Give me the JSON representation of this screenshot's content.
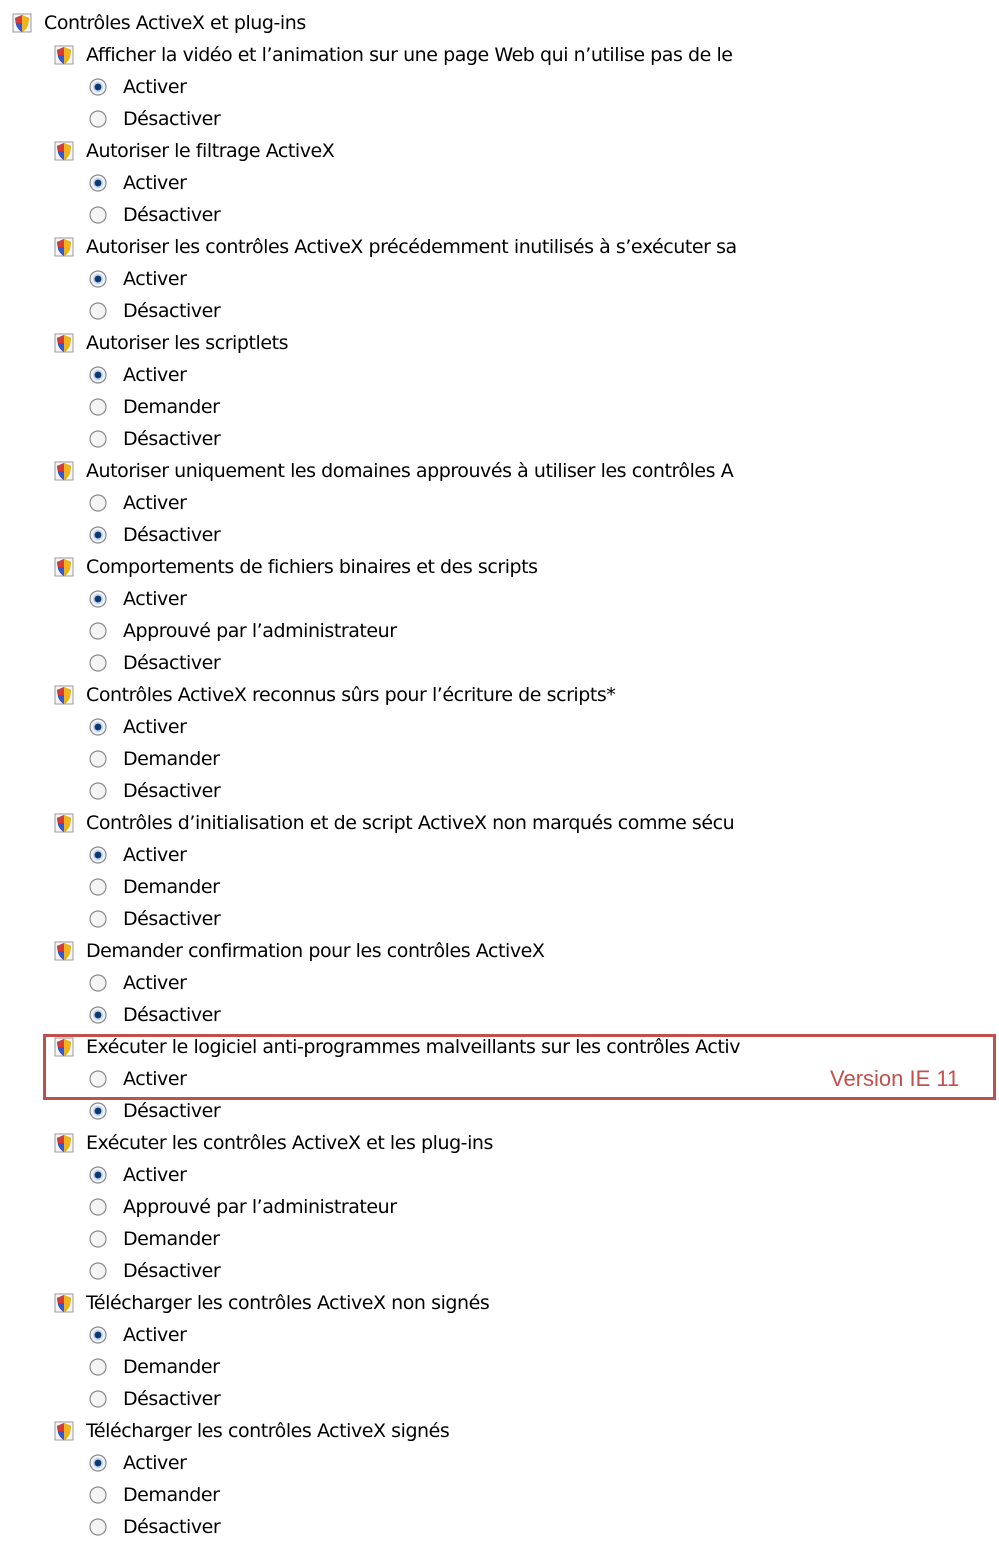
{
  "root": {
    "label": "Contrôles ActiveX et plug-ins",
    "icon": "security-settings-icon"
  },
  "settings": [
    {
      "label": "Afficher la vidéo et l’animation sur une page Web qui n’utilise pas de le",
      "icon": "security-settings-icon",
      "options": [
        {
          "label": "Activer",
          "selected": true
        },
        {
          "label": "Désactiver",
          "selected": false
        }
      ]
    },
    {
      "label": "Autoriser le filtrage ActiveX",
      "icon": "security-settings-icon",
      "options": [
        {
          "label": "Activer",
          "selected": true
        },
        {
          "label": "Désactiver",
          "selected": false
        }
      ]
    },
    {
      "label": "Autoriser les contrôles ActiveX précédemment inutilisés à s’exécuter sa",
      "icon": "security-settings-icon",
      "options": [
        {
          "label": "Activer",
          "selected": true
        },
        {
          "label": "Désactiver",
          "selected": false
        }
      ]
    },
    {
      "label": "Autoriser les scriptlets",
      "icon": "security-settings-icon",
      "options": [
        {
          "label": "Activer",
          "selected": true
        },
        {
          "label": "Demander",
          "selected": false
        },
        {
          "label": "Désactiver",
          "selected": false
        }
      ]
    },
    {
      "label": "Autoriser uniquement les domaines approuvés à utiliser les contrôles A",
      "icon": "security-settings-icon",
      "options": [
        {
          "label": "Activer",
          "selected": false
        },
        {
          "label": "Désactiver",
          "selected": true
        }
      ]
    },
    {
      "label": "Comportements de fichiers binaires et des scripts",
      "icon": "security-settings-icon",
      "options": [
        {
          "label": "Activer",
          "selected": true
        },
        {
          "label": "Approuvé par l’administrateur",
          "selected": false
        },
        {
          "label": "Désactiver",
          "selected": false
        }
      ]
    },
    {
      "label": "Contrôles ActiveX reconnus sûrs pour l’écriture de scripts*",
      "icon": "security-settings-icon",
      "options": [
        {
          "label": "Activer",
          "selected": true
        },
        {
          "label": "Demander",
          "selected": false
        },
        {
          "label": "Désactiver",
          "selected": false
        }
      ]
    },
    {
      "label": "Contrôles d’initialisation et de script ActiveX non marqués comme sécu",
      "icon": "security-settings-icon",
      "options": [
        {
          "label": "Activer",
          "selected": true
        },
        {
          "label": "Demander",
          "selected": false
        },
        {
          "label": "Désactiver",
          "selected": false
        }
      ]
    },
    {
      "label": "Demander confirmation pour les contrôles ActiveX",
      "icon": "security-settings-icon",
      "options": [
        {
          "label": "Activer",
          "selected": false
        },
        {
          "label": "Désactiver",
          "selected": true
        }
      ]
    },
    {
      "label": "Exécuter le logiciel anti-programmes malveillants sur les contrôles Activ",
      "icon": "security-settings-icon",
      "highlighted": true,
      "options": [
        {
          "label": "Activer",
          "selected": false
        },
        {
          "label": "Désactiver",
          "selected": true
        }
      ]
    },
    {
      "label": "Exécuter les contrôles ActiveX et les plug-ins",
      "icon": "security-settings-icon",
      "options": [
        {
          "label": "Activer",
          "selected": true
        },
        {
          "label": "Approuvé par l’administrateur",
          "selected": false
        },
        {
          "label": "Demander",
          "selected": false
        },
        {
          "label": "Désactiver",
          "selected": false
        }
      ]
    },
    {
      "label": "Télécharger les contrôles ActiveX non signés",
      "icon": "security-settings-icon",
      "options": [
        {
          "label": "Activer",
          "selected": true
        },
        {
          "label": "Demander",
          "selected": false
        },
        {
          "label": "Désactiver",
          "selected": false
        }
      ]
    },
    {
      "label": "Télécharger les contrôles ActiveX signés",
      "icon": "security-settings-icon",
      "options": [
        {
          "label": "Activer",
          "selected": true
        },
        {
          "label": "Demander",
          "selected": false
        },
        {
          "label": "Désactiver",
          "selected": false
        }
      ]
    }
  ],
  "annotation": {
    "text": "Version IE 11",
    "color": "#c0504d"
  },
  "colors": {
    "radio_dot": "#0b3a6e",
    "radio_border": "#8a8a8a",
    "icon_shield": "#3a57c7",
    "icon_gold": "#f0b418"
  }
}
